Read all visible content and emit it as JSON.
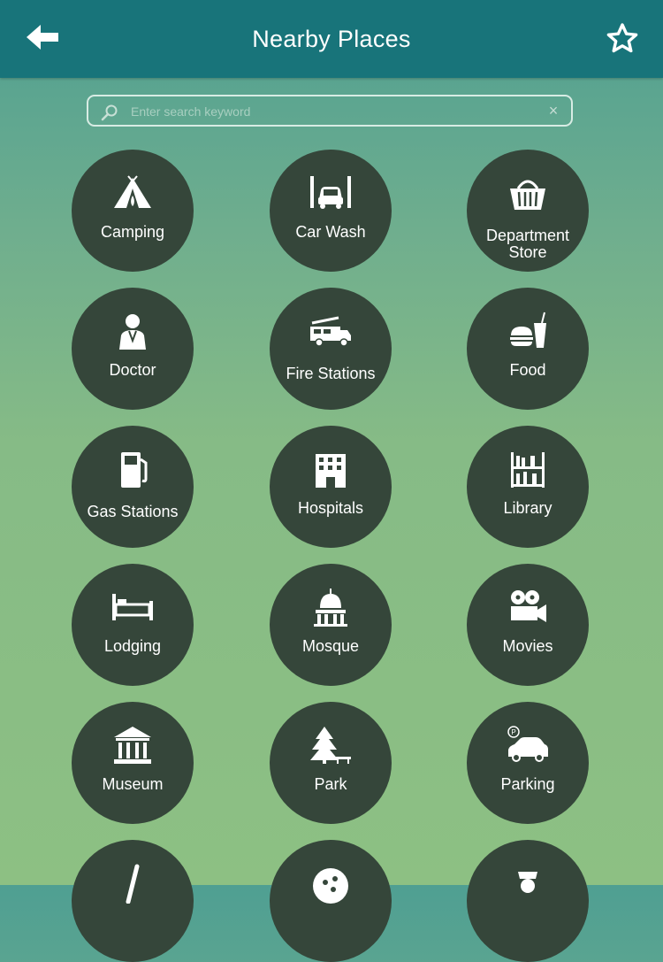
{
  "header": {
    "title": "Nearby Places",
    "back_icon": "arrow-left-icon",
    "favorite_icon": "star-icon"
  },
  "search": {
    "placeholder": "Enter search keyword",
    "value": ""
  },
  "categories": [
    {
      "label": "Camping",
      "icon": "tent-icon"
    },
    {
      "label": "Car Wash",
      "icon": "car-wash-icon"
    },
    {
      "label": "Department Store",
      "icon": "basket-icon"
    },
    {
      "label": "Doctor",
      "icon": "doctor-icon"
    },
    {
      "label": "Fire Stations",
      "icon": "fire-truck-icon"
    },
    {
      "label": "Food",
      "icon": "burger-drink-icon"
    },
    {
      "label": "Gas Stations",
      "icon": "gas-pump-icon"
    },
    {
      "label": "Hospitals",
      "icon": "hospital-building-icon"
    },
    {
      "label": "Library",
      "icon": "bookshelf-icon"
    },
    {
      "label": "Lodging",
      "icon": "bed-icon"
    },
    {
      "label": "Mosque",
      "icon": "dome-icon"
    },
    {
      "label": "Movies",
      "icon": "film-camera-icon"
    },
    {
      "label": "Museum",
      "icon": "museum-icon"
    },
    {
      "label": "Park",
      "icon": "tree-bench-icon"
    },
    {
      "label": "Parking",
      "icon": "parked-car-icon"
    }
  ],
  "colors": {
    "header_bg": "#18747a",
    "tile_bg": "#35463a",
    "text": "#ffffff"
  }
}
